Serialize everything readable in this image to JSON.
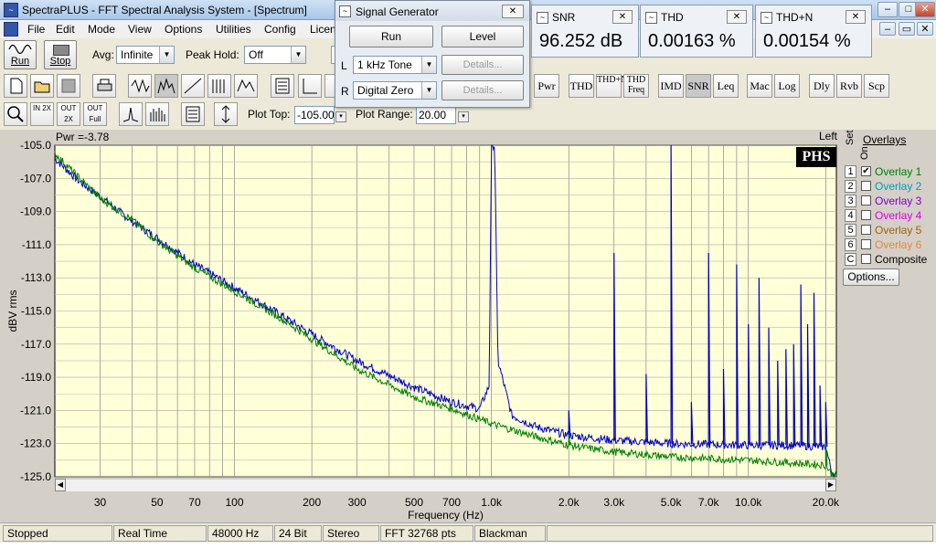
{
  "window": {
    "title": "SpectraPLUS - FFT Spectral Analysis System - [Spectrum]",
    "app_icon": "waveform-icon"
  },
  "menu": [
    "File",
    "Edit",
    "Mode",
    "View",
    "Options",
    "Utilities",
    "Config",
    "Licen"
  ],
  "toolbar1": {
    "run_label": "Run",
    "stop_label": "Stop",
    "avg_label": "Avg:",
    "avg_value": "Infinite",
    "peak_hold_label": "Peak Hold:",
    "peak_hold_value": "Off"
  },
  "signal_generator": {
    "title": "Signal Generator",
    "run_label": "Run",
    "level_label": "Level",
    "left_ch": "L",
    "left_value": "1 kHz Tone",
    "right_ch": "R",
    "right_value": "Digital Zero",
    "details_label": "Details..."
  },
  "meters": [
    {
      "name": "SNR",
      "value": "96.252 dB"
    },
    {
      "name": "THD",
      "value": "0.00163 %"
    },
    {
      "name": "THD+N",
      "value": "0.00154 %"
    }
  ],
  "toolbar_text_buttons": [
    "Pwr",
    "THD",
    "THD+N",
    "THD Freq",
    "IMD",
    "SNR",
    "Leq",
    "Mac",
    "Log",
    "Dly",
    "Rvb",
    "Scp"
  ],
  "toolbar3": {
    "plot_top_label": "Plot Top:",
    "plot_top_value": "-105.00",
    "plot_range_label": "Plot Range:",
    "plot_range_value": "20.00",
    "zoom_labels": [
      "IN 2X",
      "OUT 2X",
      "OUT Full"
    ]
  },
  "plot": {
    "pwr_label": "Pwr =-3.78",
    "channel_label": "Left",
    "logo": "PHS"
  },
  "overlays": {
    "header": "Overlays",
    "set_label": "Set",
    "on_label": "On",
    "items": [
      {
        "set": "1",
        "name": "Overlay 1",
        "color": "#008000",
        "checked": "✔"
      },
      {
        "set": "2",
        "name": "Overlay 2",
        "color": "#00a0b0",
        "checked": ""
      },
      {
        "set": "3",
        "name": "Overlay 3",
        "color": "#8000c0",
        "checked": ""
      },
      {
        "set": "4",
        "name": "Overlay 4",
        "color": "#e000e0",
        "checked": ""
      },
      {
        "set": "5",
        "name": "Overlay 5",
        "color": "#a06000",
        "checked": ""
      },
      {
        "set": "6",
        "name": "Overlay 6",
        "color": "#f08040",
        "checked": ""
      },
      {
        "set": "C",
        "name": "Composite",
        "color": "#000000",
        "checked": ""
      }
    ],
    "options_label": "Options..."
  },
  "status": [
    "Stopped",
    "Real Time",
    "48000 Hz",
    "24 Bit",
    "Stereo",
    "FFT 32768 pts",
    "Blackman"
  ],
  "chart_data": {
    "type": "line",
    "xlabel": "Frequency (Hz)",
    "ylabel": "dBV rms",
    "x_scale": "log",
    "xlim": [
      20,
      22000
    ],
    "ylim": [
      -125,
      -105
    ],
    "yticks": [
      "-105.0",
      "-107.0",
      "-109.0",
      "-111.0",
      "-113.0",
      "-115.0",
      "-117.0",
      "-119.0",
      "-121.0",
      "-123.0",
      "-125.0"
    ],
    "xticks": [
      {
        "v": 30,
        "label": "30"
      },
      {
        "v": 50,
        "label": "50"
      },
      {
        "v": 70,
        "label": "70"
      },
      {
        "v": 100,
        "label": "100"
      },
      {
        "v": 200,
        "label": "200"
      },
      {
        "v": 300,
        "label": "300"
      },
      {
        "v": 500,
        "label": "500"
      },
      {
        "v": 700,
        "label": "700"
      },
      {
        "v": 1000,
        "label": "1.0k"
      },
      {
        "v": 2000,
        "label": "2.0k"
      },
      {
        "v": 3000,
        "label": "3.0k"
      },
      {
        "v": 5000,
        "label": "5.0k"
      },
      {
        "v": 7000,
        "label": "7.0k"
      },
      {
        "v": 10000,
        "label": "10.0k"
      },
      {
        "v": 20000,
        "label": "20.0k"
      }
    ],
    "grid": true,
    "background": "#ffffd8",
    "series": [
      {
        "color": "#0000c0",
        "points": [
          [
            20,
            -105.8
          ],
          [
            25,
            -107.2
          ],
          [
            30,
            -108.1
          ],
          [
            40,
            -109.6
          ],
          [
            50,
            -110.6
          ],
          [
            70,
            -112.2
          ],
          [
            100,
            -113.6
          ],
          [
            150,
            -115.2
          ],
          [
            200,
            -116.4
          ],
          [
            300,
            -118.0
          ],
          [
            500,
            -119.6
          ],
          [
            700,
            -120.5
          ],
          [
            900,
            -120.9
          ],
          [
            980,
            -119.5
          ],
          [
            1000,
            -105.0
          ],
          [
            1030,
            -105.0
          ],
          [
            1060,
            -118.0
          ],
          [
            1200,
            -121.3
          ],
          [
            1500,
            -122.0
          ],
          [
            2000,
            -122.5
          ],
          [
            3000,
            -122.8
          ],
          [
            5000,
            -123.0
          ],
          [
            10000,
            -123.1
          ],
          [
            15000,
            -123.1
          ],
          [
            20000,
            -123.2
          ],
          [
            21000,
            -124.6
          ],
          [
            22000,
            -125.0
          ]
        ],
        "harmonics": [
          [
            2000,
            -121.0
          ],
          [
            3000,
            -111.5
          ],
          [
            4000,
            -118.8
          ],
          [
            5000,
            -105.0
          ],
          [
            6000,
            -120.5
          ],
          [
            7000,
            -111.5
          ],
          [
            8000,
            -118.5
          ],
          [
            9000,
            -112.2
          ],
          [
            10000,
            -115.8
          ],
          [
            11000,
            -113.0
          ],
          [
            12000,
            -116.0
          ],
          [
            13000,
            -118.0
          ],
          [
            14000,
            -117.3
          ],
          [
            15000,
            -117.0
          ],
          [
            16000,
            -113.4
          ],
          [
            17000,
            -115.8
          ],
          [
            18000,
            -113.9
          ],
          [
            19000,
            -119.5
          ],
          [
            20000,
            -120.5
          ]
        ]
      },
      {
        "name": "Overlay 1",
        "color": "#008000",
        "points": [
          [
            20,
            -105.5
          ],
          [
            25,
            -107.0
          ],
          [
            30,
            -108.2
          ],
          [
            40,
            -109.5
          ],
          [
            50,
            -110.8
          ],
          [
            70,
            -112.4
          ],
          [
            100,
            -113.8
          ],
          [
            150,
            -115.4
          ],
          [
            200,
            -116.7
          ],
          [
            300,
            -118.5
          ],
          [
            500,
            -120.2
          ],
          [
            700,
            -120.9
          ],
          [
            1000,
            -121.8
          ],
          [
            1500,
            -122.6
          ],
          [
            2000,
            -123.1
          ],
          [
            3000,
            -123.5
          ],
          [
            5000,
            -123.8
          ],
          [
            10000,
            -124.0
          ],
          [
            20000,
            -124.3
          ],
          [
            21000,
            -124.8
          ],
          [
            22000,
            -125.0
          ]
        ],
        "harmonics": [
          [
            2000,
            -122.5
          ],
          [
            20000,
            -123.0
          ]
        ]
      }
    ]
  }
}
